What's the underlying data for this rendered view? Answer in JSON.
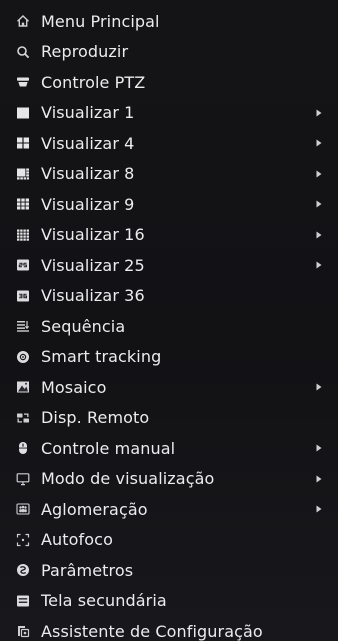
{
  "menu": {
    "items": [
      {
        "label": "Menu Principal",
        "icon": "home-icon",
        "submenu": false
      },
      {
        "label": "Reproduzir",
        "icon": "search-icon",
        "submenu": false
      },
      {
        "label": "Controle PTZ",
        "icon": "ptz-camera-icon",
        "submenu": false
      },
      {
        "label": "Visualizar 1",
        "icon": "view-1-icon",
        "submenu": true
      },
      {
        "label": "Visualizar 4",
        "icon": "view-4-icon",
        "submenu": true
      },
      {
        "label": "Visualizar 8",
        "icon": "view-8-icon",
        "submenu": true
      },
      {
        "label": "Visualizar 9",
        "icon": "view-9-icon",
        "submenu": true
      },
      {
        "label": "Visualizar 16",
        "icon": "view-16-icon",
        "submenu": true
      },
      {
        "label": "Visualizar 25",
        "icon": "view-25-icon",
        "submenu": true
      },
      {
        "label": "Visualizar 36",
        "icon": "view-36-icon",
        "submenu": false
      },
      {
        "label": "Sequência",
        "icon": "sequence-icon",
        "submenu": false
      },
      {
        "label": "Smart tracking",
        "icon": "smart-tracking-icon",
        "submenu": false
      },
      {
        "label": "Mosaico",
        "icon": "mosaic-icon",
        "submenu": true
      },
      {
        "label": "Disp. Remoto",
        "icon": "remote-device-icon",
        "submenu": false
      },
      {
        "label": "Controle manual",
        "icon": "manual-control-icon",
        "submenu": true
      },
      {
        "label": "Modo de visualização",
        "icon": "monitor-icon",
        "submenu": true
      },
      {
        "label": "Aglomeração",
        "icon": "crowd-icon",
        "submenu": true
      },
      {
        "label": "Autofoco",
        "icon": "autofocus-icon",
        "submenu": false
      },
      {
        "label": "Parâmetros",
        "icon": "parameters-icon",
        "submenu": false
      },
      {
        "label": "Tela secundária",
        "icon": "secondary-screen-icon",
        "submenu": false
      },
      {
        "label": "Assistente de Configuração",
        "icon": "setup-wizard-icon",
        "submenu": false
      }
    ],
    "submenu_arrow_icon": "chevron-right-icon"
  }
}
